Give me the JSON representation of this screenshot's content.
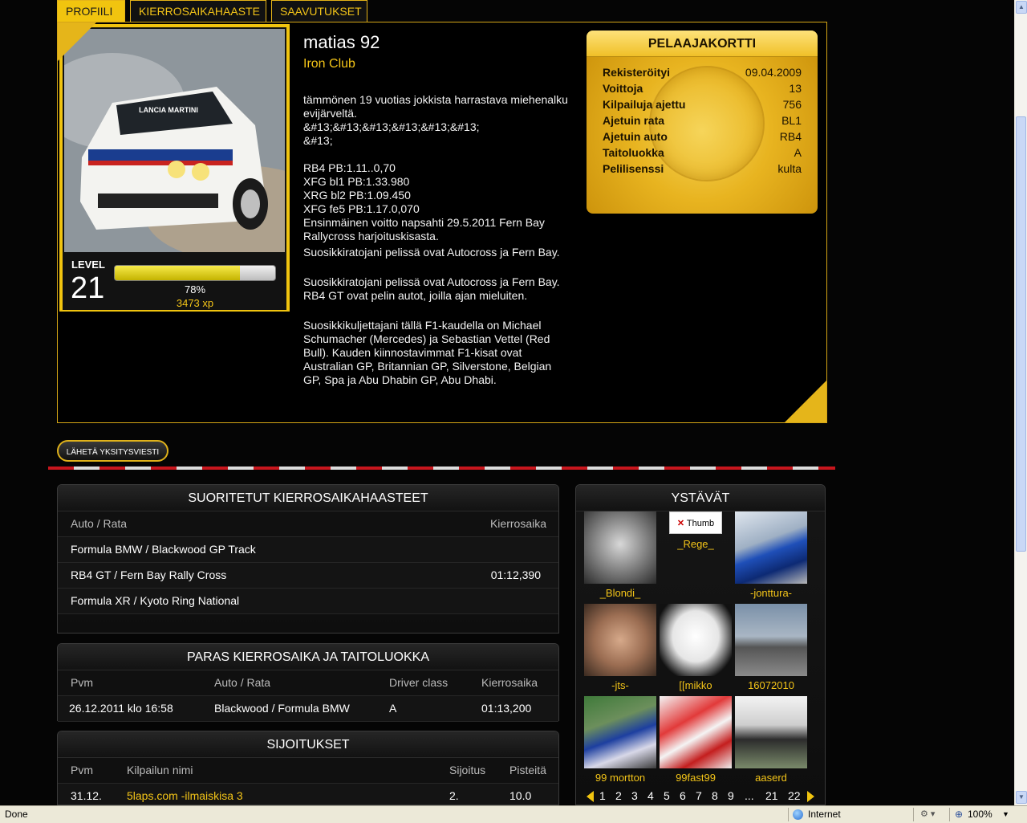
{
  "tabs": [
    {
      "label": "PROFIILI",
      "active": true
    },
    {
      "label": "KIERROSAIKAHAASTE",
      "active": false
    },
    {
      "label": "SAAVUTUKSET",
      "active": false
    }
  ],
  "profile": {
    "name": "matias 92",
    "club": "Iron Club",
    "photo_text": "LANCIA MARTINI",
    "level_label": "LEVEL",
    "level": "21",
    "progress_percent": 78,
    "progress_text": "78%",
    "xp": "3473 xp",
    "bio": [
      "tämmönen 19 vuotias jokkista harrastava miehenalku evijärveltä.",
      "&#13;&#13;&#13;&#13;&#13;&#13;",
      "&#13;",
      "",
      "RB4 PB:1.11..0,70",
      "XFG bl1 PB:1.33.980",
      "XRG bl2 PB:1.09.450",
      "XFG fe5 PB:1.17.0,070",
      "Ensinmäinen voitto napsahti 29.5.2011 Fern Bay Rallycross harjoituskisasta."
    ],
    "paragraphs": [
      "Suosikkiratojani pelissä ovat Autocross ja Fern Bay.",
      "Suosikkiratojani pelissä ovat Autocross ja Fern Bay. RB4 GT ovat pelin autot, joilla ajan mieluiten.",
      "Suosikkikuljettajani tällä F1-kaudella on Michael Schumacher (Mercedes) ja Sebastian Vettel (Red Bull). Kauden kiinnostavimmat F1-kisat ovat Australian GP, Britannian GP, Silverstone, Belgian GP, Spa ja Abu Dhabin GP, Abu Dhabi."
    ]
  },
  "card": {
    "title": "PELAAJAKORTTI",
    "rows": [
      {
        "k": "Rekisteröityi",
        "v": "09.04.2009"
      },
      {
        "k": "Voittoja",
        "v": "13"
      },
      {
        "k": "Kilpailuja ajettu",
        "v": "756"
      },
      {
        "k": "Ajetuin rata",
        "v": "BL1"
      },
      {
        "k": "Ajetuin auto",
        "v": "RB4"
      },
      {
        "k": "Taitoluokka",
        "v": "A"
      },
      {
        "k": "Pelilisenssi",
        "v": "kulta"
      }
    ]
  },
  "message_button": "LÄHETÄ YKSITYSVIESTI",
  "challenges": {
    "title": "SUORITETUT KIERROSAIKAHAASTEET",
    "col_car": "Auto / Rata",
    "col_time": "Kierrosaika",
    "rows": [
      {
        "track": "Formula BMW / Blackwood GP Track",
        "time": ""
      },
      {
        "track": "RB4 GT / Fern Bay Rally Cross",
        "time": "01:12,390"
      },
      {
        "track": "Formula XR / Kyoto Ring National",
        "time": ""
      }
    ]
  },
  "best": {
    "title": "PARAS KIERROSAIKA JA TAITOLUOKKA",
    "cols": [
      "Pvm",
      "Auto / Rata",
      "Driver class",
      "Kierrosaika"
    ],
    "row": [
      "26.12.2011 klo 16:58",
      "Blackwood / Formula BMW",
      "A",
      "01:13,200"
    ]
  },
  "rankings": {
    "title": "SIJOITUKSET",
    "cols": [
      "Pvm",
      "Kilpailun nimi",
      "Sijoitus",
      "Pisteitä"
    ],
    "row": [
      "31.12.",
      "5laps.com -ilmaiskisa 3",
      "2.",
      "10.0"
    ]
  },
  "friends": {
    "title": "YSTÄVÄT",
    "thumb_alt": "Thumb",
    "items": [
      "_Blondi_",
      "_Rege_",
      "-jonttura-",
      "-jts-",
      "[[mikko",
      "16072010",
      "99 mortton",
      "99fast99",
      "aaserd"
    ],
    "pages": [
      "1",
      "2",
      "3",
      "4",
      "5",
      "6",
      "7",
      "8",
      "9",
      "...",
      "21",
      "22"
    ]
  },
  "status": {
    "left": "Done",
    "zone": "Internet",
    "zoom": "100%"
  }
}
